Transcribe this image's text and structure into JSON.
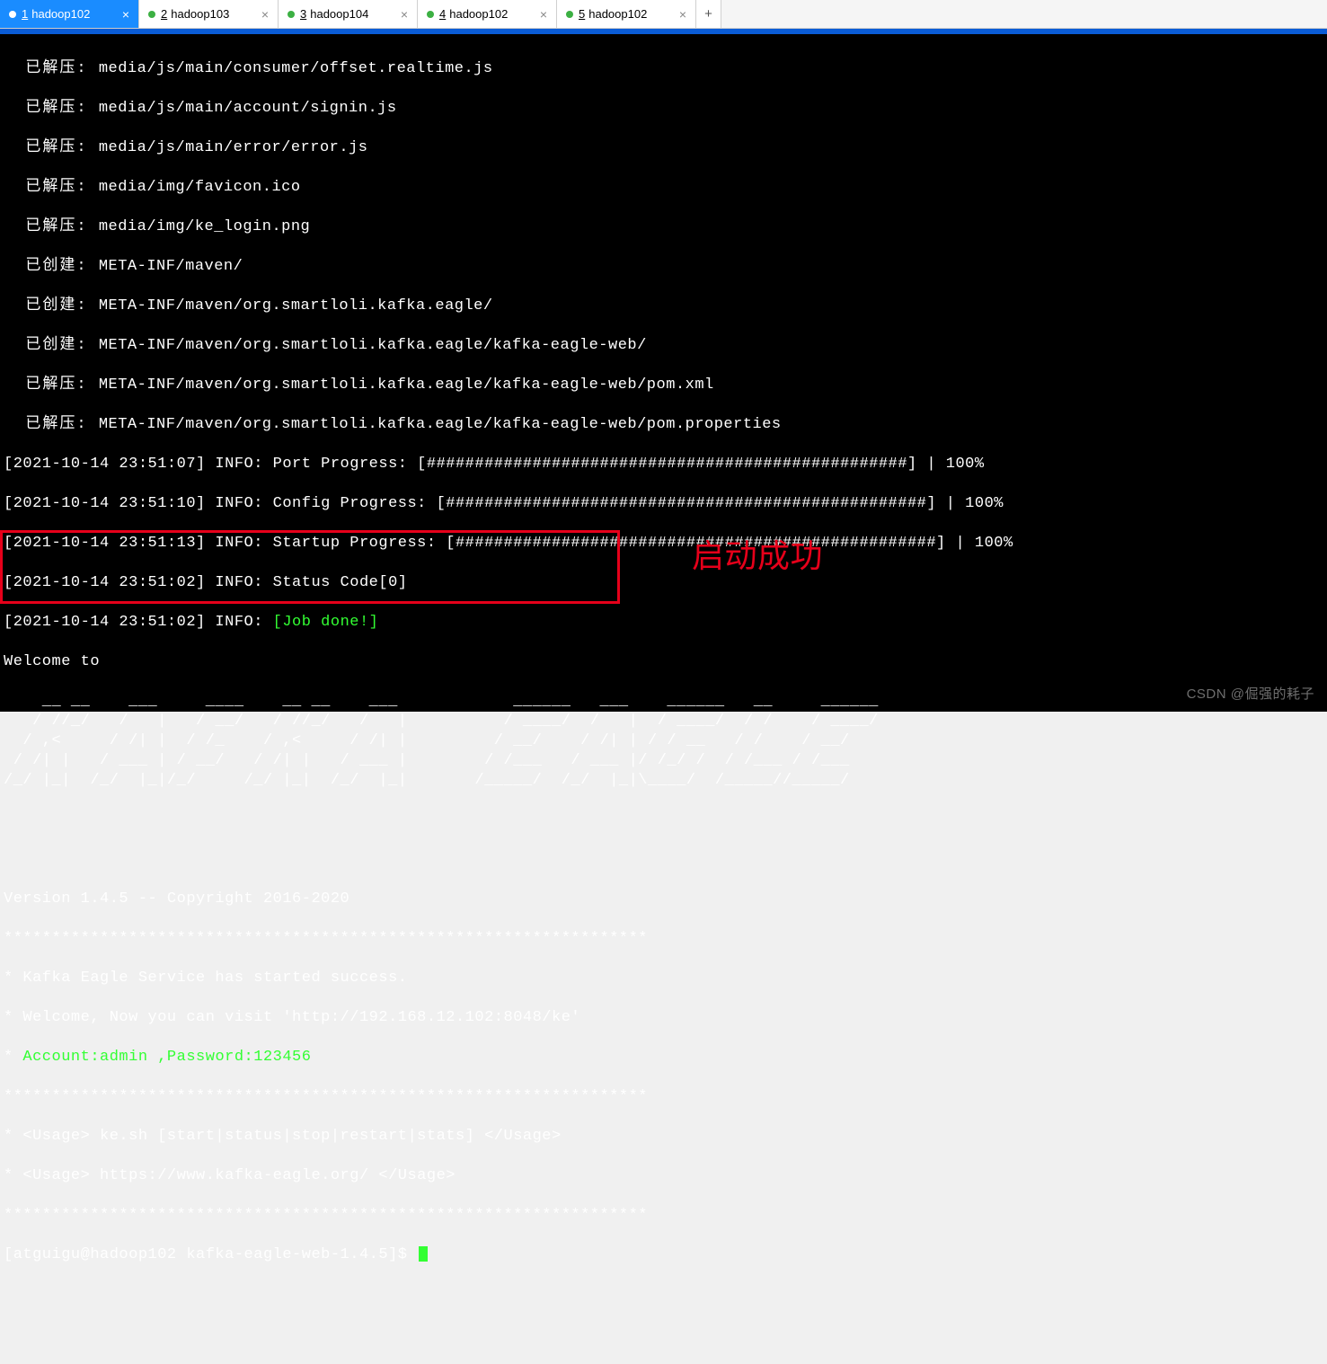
{
  "tabs": [
    {
      "num": "1",
      "label": "hadoop102",
      "active": true
    },
    {
      "num": "2",
      "label": "hadoop103",
      "active": false
    },
    {
      "num": "3",
      "label": "hadoop104",
      "active": false
    },
    {
      "num": "4",
      "label": "hadoop102",
      "active": false
    },
    {
      "num": "5",
      "label": "hadoop102",
      "active": false
    }
  ],
  "add_tab": "+",
  "close_glyph": "×",
  "extract_lines": [
    {
      "prefix": "  已解压: ",
      "path": "media/js/main/consumer/offset.realtime.js"
    },
    {
      "prefix": "  已解压: ",
      "path": "media/js/main/account/signin.js"
    },
    {
      "prefix": "  已解压: ",
      "path": "media/js/main/error/error.js"
    },
    {
      "prefix": "  已解压: ",
      "path": "media/img/favicon.ico"
    },
    {
      "prefix": "  已解压: ",
      "path": "media/img/ke_login.png"
    },
    {
      "prefix": "  已创建: ",
      "path": "META-INF/maven/"
    },
    {
      "prefix": "  已创建: ",
      "path": "META-INF/maven/org.smartloli.kafka.eagle/"
    },
    {
      "prefix": "  已创建: ",
      "path": "META-INF/maven/org.smartloli.kafka.eagle/kafka-eagle-web/"
    },
    {
      "prefix": "  已解压: ",
      "path": "META-INF/maven/org.smartloli.kafka.eagle/kafka-eagle-web/pom.xml"
    },
    {
      "prefix": "  已解压: ",
      "path": "META-INF/maven/org.smartloli.kafka.eagle/kafka-eagle-web/pom.properties"
    }
  ],
  "progress_lines": [
    "[2021-10-14 23:51:07] INFO: Port Progress: [##################################################] | 100%",
    "[2021-10-14 23:51:10] INFO: Config Progress: [##################################################] | 100%",
    "[2021-10-14 23:51:13] INFO: Startup Progress: [##################################################] | 100%",
    "[2021-10-14 23:51:02] INFO: Status Code[0]"
  ],
  "job_done_prefix": "[2021-10-14 23:51:02] INFO: ",
  "job_done_text": "[Job done!]",
  "welcome": "Welcome to",
  "ascii_art": "    __ __    ___     ____    __ __    ___            ______   ___    ______   __     ______\n   / //_/   /   |   / __/   / //_/   /   |          / ____/  /   |  / ____/  / /    / ____/\n  / ,<     / /| |  / /_    / ,<     / /| |         / __/    / /| | / / __   / /    / __/   \n / /| |   / ___ | / __/   / /| |   / ___ |        / /___   / ___ |/ /_/ /  / /___ / /___   \n/_/ |_|  /_/  |_|/_/     /_/ |_|  /_/  |_|       /_____/  /_/  |_|\\____/  /_____//_____/   ",
  "version_line": "Version 1.4.5 -- Copyright 2016-2020",
  "stars_line": "*******************************************************************",
  "service_line1": "* Kafka Eagle Service has started success.",
  "service_line2": "* Welcome, Now you can visit 'http://192.168.12.102:8048/ke'",
  "account_prefix": "* ",
  "account_text": "Account:admin ,Password:123456",
  "usage1": "* <Usage> ke.sh [start|status|stop|restart|stats] </Usage>",
  "usage2": "* <Usage> https://www.kafka-eagle.org/ </Usage>",
  "prompt": "[atguigu@hadoop102 kafka-eagle-web-1.4.5]$ ",
  "annotation": "启动成功",
  "watermark": "CSDN @倔强的耗子"
}
